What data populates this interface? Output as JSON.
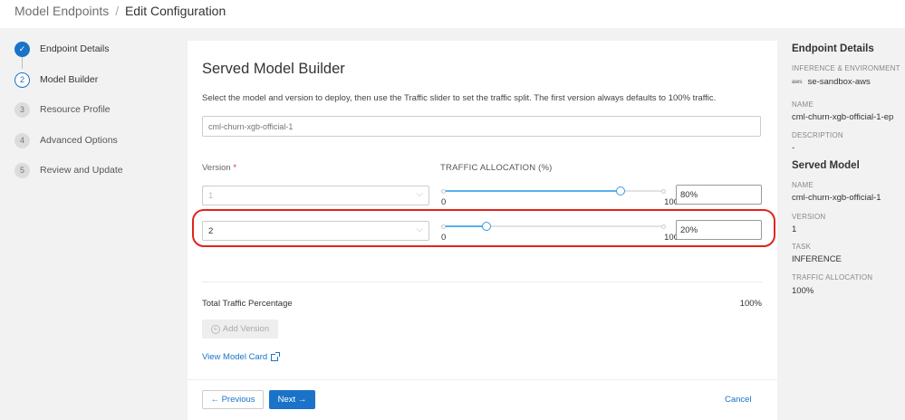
{
  "breadcrumb": {
    "parent": "Model Endpoints",
    "separator": "/",
    "current": "Edit Configuration"
  },
  "steps": [
    {
      "num": "✓",
      "label": "Endpoint Details",
      "state": "done"
    },
    {
      "num": "2",
      "label": "Model Builder",
      "state": "active"
    },
    {
      "num": "3",
      "label": "Resource Profile",
      "state": "todo"
    },
    {
      "num": "4",
      "label": "Advanced Options",
      "state": "todo"
    },
    {
      "num": "5",
      "label": "Review and Update",
      "state": "todo"
    }
  ],
  "builder": {
    "title": "Served Model Builder",
    "description": "Select the model and version to deploy, then use the Traffic slider to set the traffic split. The first version always defaults to 100% traffic.",
    "model_placeholder": "cml-churn-xgb-official-1",
    "version_label": "Version",
    "required_mark": "*",
    "traffic_label": "TRAFFIC ALLOCATION (%)",
    "rows": [
      {
        "version": "1",
        "slider_min": "0",
        "slider_max": "100",
        "traffic_value": 80,
        "traffic_text": "80%"
      },
      {
        "version": "2",
        "slider_min": "0",
        "slider_max": "100",
        "traffic_value": 20,
        "traffic_text": "20%"
      }
    ],
    "total_label": "Total Traffic Percentage",
    "total_value": "100%",
    "add_version_label": "Add Version",
    "view_model_card_label": "View Model Card",
    "prev_label": "← Previous",
    "next_label": "Next →",
    "cancel_label": "Cancel"
  },
  "panel": {
    "endpoint_heading": "Endpoint Details",
    "inference_key": "INFERENCE & ENVIRONMENT",
    "aws_icon": "aws",
    "inference_value": "se-sandbox-aws",
    "name_key": "NAME",
    "name_value": "cml-churn-xgb-official-1-ep",
    "description_key": "DESCRIPTION",
    "description_value": "-",
    "served_heading": "Served Model",
    "model_name_key": "NAME",
    "model_name_value": "cml-churn-xgb-official-1",
    "version_key": "VERSION",
    "version_value": "1",
    "task_key": "TASK",
    "task_value": "INFERENCE",
    "traffic_key": "TRAFFIC ALLOCATION",
    "traffic_value": "100%"
  },
  "colors": {
    "accent": "#1a73c8",
    "slider": "#5ab0ec",
    "highlight": "#e0241c"
  }
}
